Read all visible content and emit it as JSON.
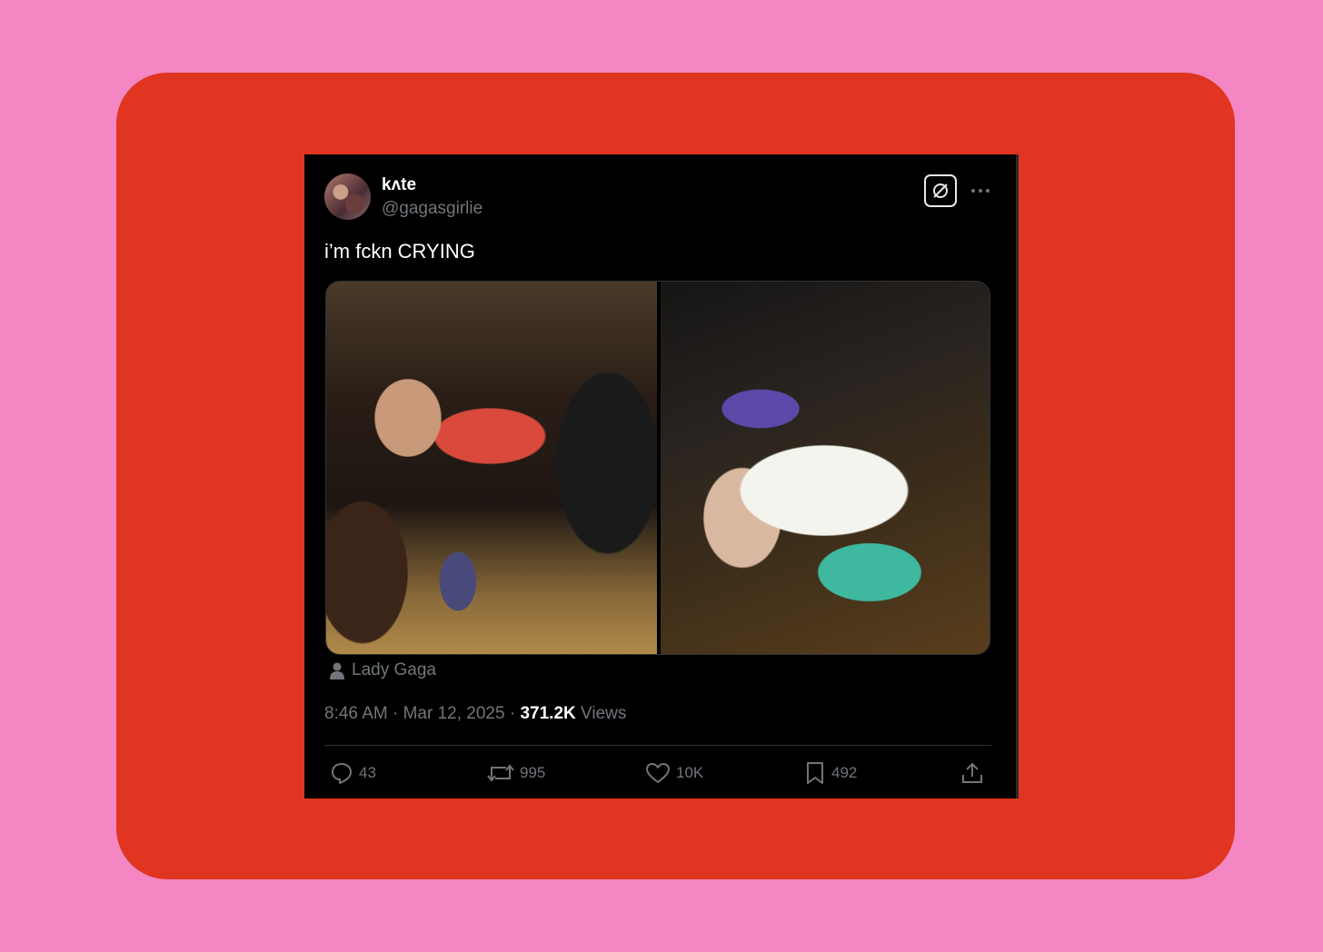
{
  "tweet": {
    "display_name": "kʌte",
    "handle": "@gagasgirlie",
    "text": "i’m fckn CRYING",
    "media_tag": "Lady Gaga",
    "time": "8:46 AM",
    "date": "Mar 12, 2025",
    "views_count": "371.2K",
    "views_label": "Views"
  },
  "actions": {
    "replies": "43",
    "reposts": "995",
    "likes": "10K",
    "bookmarks": "492"
  },
  "colors": {
    "page_background": "#f386c3",
    "card_background": "#e03520",
    "tweet_background": "#000000"
  },
  "icons": [
    "grok-icon",
    "more-icon",
    "person-icon",
    "reply-icon",
    "repost-icon",
    "like-icon",
    "bookmark-icon",
    "share-icon"
  ]
}
